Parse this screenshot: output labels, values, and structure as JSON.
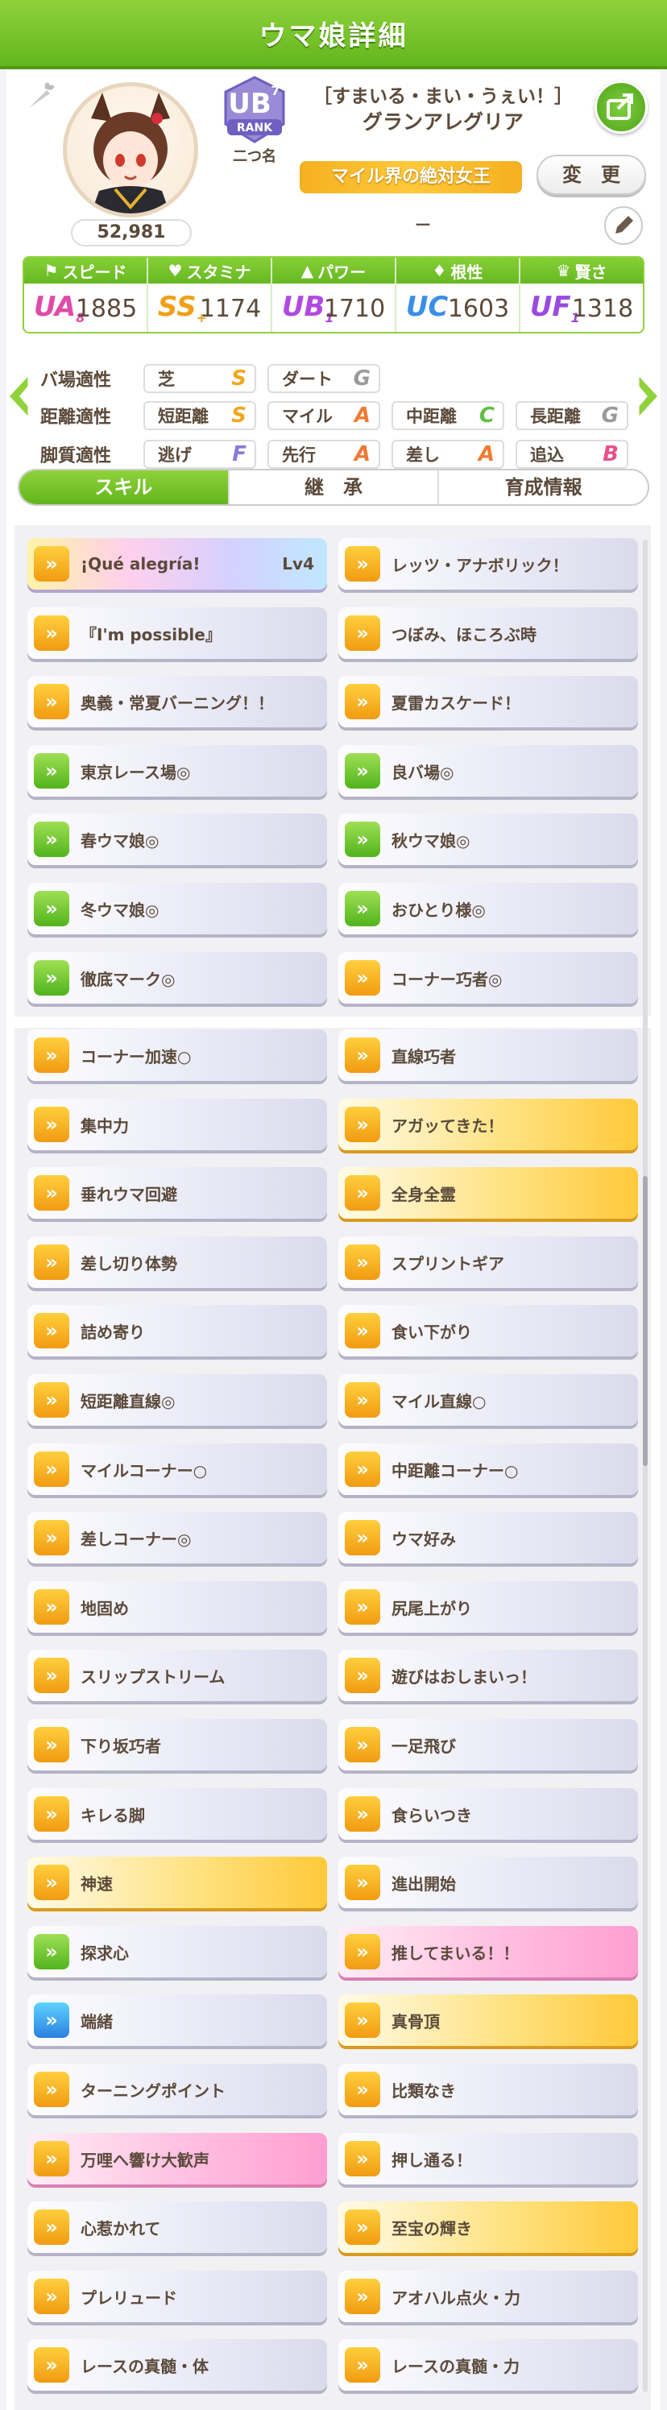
{
  "header": {
    "title": "ウマ娘詳細"
  },
  "profile": {
    "fans": "52,981",
    "rank_label": "RANK",
    "rank_grade": "UB",
    "rank_sub": "7",
    "rank_name": "二つ名",
    "epithet": "［すまいる・まい・うぇい！］",
    "name": "グランアレグリア",
    "nickname": "マイル界の絶対女王",
    "change_label": "変　更",
    "memo": "－"
  },
  "stats": [
    {
      "label": "スピード",
      "grade": "UA",
      "grade_sub": "8",
      "value": "1885",
      "color": "#e14aa8"
    },
    {
      "label": "スタミナ",
      "grade": "SS",
      "grade_sub": "+",
      "value": "1174",
      "color": "#f0a018"
    },
    {
      "label": "パワー",
      "grade": "UB",
      "grade_sub": "1",
      "value": "1710",
      "color": "#b14ae0"
    },
    {
      "label": "根性",
      "grade": "UC",
      "grade_sub": "",
      "value": "1603",
      "color": "#3a8ee8"
    },
    {
      "label": "賢さ",
      "grade": "UF",
      "grade_sub": "1",
      "value": "1318",
      "color": "#9a4ae0"
    }
  ],
  "aptitude": [
    {
      "label": "バ場適性",
      "items": [
        {
          "name": "芝",
          "grade": "S",
          "color": "#f0a818"
        },
        {
          "name": "ダート",
          "grade": "G",
          "color": "#9a9a9a"
        }
      ]
    },
    {
      "label": "距離適性",
      "items": [
        {
          "name": "短距離",
          "grade": "S",
          "color": "#f0a818"
        },
        {
          "name": "マイル",
          "grade": "A",
          "color": "#f07a30"
        },
        {
          "name": "中距離",
          "grade": "C",
          "color": "#5cc040"
        },
        {
          "name": "長距離",
          "grade": "G",
          "color": "#9a9a9a"
        }
      ]
    },
    {
      "label": "脚質適性",
      "items": [
        {
          "name": "逃げ",
          "grade": "F",
          "color": "#8a7ad8"
        },
        {
          "name": "先行",
          "grade": "A",
          "color": "#f07a30"
        },
        {
          "name": "差し",
          "grade": "A",
          "color": "#f07a30"
        },
        {
          "name": "追込",
          "grade": "B",
          "color": "#e8508a"
        }
      ]
    }
  ],
  "tabs": [
    "スキル",
    "継　承",
    "育成情報"
  ],
  "skills": [
    {
      "name": "¡Qué alegría!",
      "lv": "Lv4",
      "style": "rainbow",
      "icon": "ic-o"
    },
    {
      "name": "レッツ・アナボリック！",
      "style": "",
      "icon": "ic-o"
    },
    {
      "name": "『I'm possible』",
      "style": "",
      "icon": "ic-o"
    },
    {
      "name": "つぼみ、ほころぶ時",
      "style": "",
      "icon": "ic-o"
    },
    {
      "name": "奥義・常夏バーニング！！",
      "style": "",
      "icon": "ic-o"
    },
    {
      "name": "夏雷カスケード！",
      "style": "",
      "icon": "ic-o"
    },
    {
      "name": "東京レース場◎",
      "style": "",
      "icon": "ic-g"
    },
    {
      "name": "良バ場◎",
      "style": "",
      "icon": "ic-g"
    },
    {
      "name": "春ウマ娘◎",
      "style": "",
      "icon": "ic-g"
    },
    {
      "name": "秋ウマ娘◎",
      "style": "",
      "icon": "ic-g"
    },
    {
      "name": "冬ウマ娘◎",
      "style": "",
      "icon": "ic-g"
    },
    {
      "name": "おひとり様◎",
      "style": "",
      "icon": "ic-g"
    },
    {
      "name": "徹底マーク◎",
      "style": "",
      "icon": "ic-g"
    },
    {
      "name": "コーナー巧者◎",
      "style": "",
      "icon": "ic-o"
    },
    {
      "name": "コーナー加速○",
      "style": "",
      "icon": "ic-o"
    },
    {
      "name": "直線巧者",
      "style": "",
      "icon": "ic-o"
    },
    {
      "name": "集中力",
      "style": "",
      "icon": "ic-o"
    },
    {
      "name": "アガッてきた！",
      "style": "gold",
      "icon": "ic-o"
    },
    {
      "name": "垂れウマ回避",
      "style": "",
      "icon": "ic-o"
    },
    {
      "name": "全身全霊",
      "style": "gold",
      "icon": "ic-o"
    },
    {
      "name": "差し切り体勢",
      "style": "",
      "icon": "ic-o"
    },
    {
      "name": "スプリントギア",
      "style": "",
      "icon": "ic-o"
    },
    {
      "name": "詰め寄り",
      "style": "",
      "icon": "ic-o"
    },
    {
      "name": "食い下がり",
      "style": "",
      "icon": "ic-o"
    },
    {
      "name": "短距離直線◎",
      "style": "",
      "icon": "ic-o"
    },
    {
      "name": "マイル直線○",
      "style": "",
      "icon": "ic-o"
    },
    {
      "name": "マイルコーナー○",
      "style": "",
      "icon": "ic-o"
    },
    {
      "name": "中距離コーナー○",
      "style": "",
      "icon": "ic-o"
    },
    {
      "name": "差しコーナー◎",
      "style": "",
      "icon": "ic-o"
    },
    {
      "name": "ウマ好み",
      "style": "",
      "icon": "ic-o"
    },
    {
      "name": "地固め",
      "style": "",
      "icon": "ic-o"
    },
    {
      "name": "尻尾上がり",
      "style": "",
      "icon": "ic-o"
    },
    {
      "name": "スリップストリーム",
      "style": "",
      "icon": "ic-o"
    },
    {
      "name": "遊びはおしまいっ！",
      "style": "",
      "icon": "ic-o"
    },
    {
      "name": "下り坂巧者",
      "style": "",
      "icon": "ic-o"
    },
    {
      "name": "一足飛び",
      "style": "",
      "icon": "ic-o"
    },
    {
      "name": "キレる脚",
      "style": "",
      "icon": "ic-o"
    },
    {
      "name": "食らいつき",
      "style": "",
      "icon": "ic-o"
    },
    {
      "name": "神速",
      "style": "gold",
      "icon": "ic-o"
    },
    {
      "name": "進出開始",
      "style": "",
      "icon": "ic-o"
    },
    {
      "name": "探求心",
      "style": "",
      "icon": "ic-g"
    },
    {
      "name": "推してまいる！！",
      "style": "pink",
      "icon": "ic-o"
    },
    {
      "name": "端緒",
      "style": "",
      "icon": "ic-b"
    },
    {
      "name": "真骨頂",
      "style": "gold",
      "icon": "ic-o"
    },
    {
      "name": "ターニングポイント",
      "style": "",
      "icon": "ic-o"
    },
    {
      "name": "比類なき",
      "style": "",
      "icon": "ic-o"
    },
    {
      "name": "万哩へ響け大歓声",
      "style": "pink",
      "icon": "ic-o"
    },
    {
      "name": "押し通る！",
      "style": "",
      "icon": "ic-o"
    },
    {
      "name": "心惹かれて",
      "style": "",
      "icon": "ic-o"
    },
    {
      "name": "至宝の輝き",
      "style": "gold",
      "icon": "ic-o"
    },
    {
      "name": "プレリュード",
      "style": "",
      "icon": "ic-o"
    },
    {
      "name": "アオハル点火・力",
      "style": "",
      "icon": "ic-o"
    },
    {
      "name": "レースの真髄・体",
      "style": "",
      "icon": "ic-o"
    },
    {
      "name": "レースの真髄・力",
      "style": "",
      "icon": "ic-o"
    }
  ]
}
